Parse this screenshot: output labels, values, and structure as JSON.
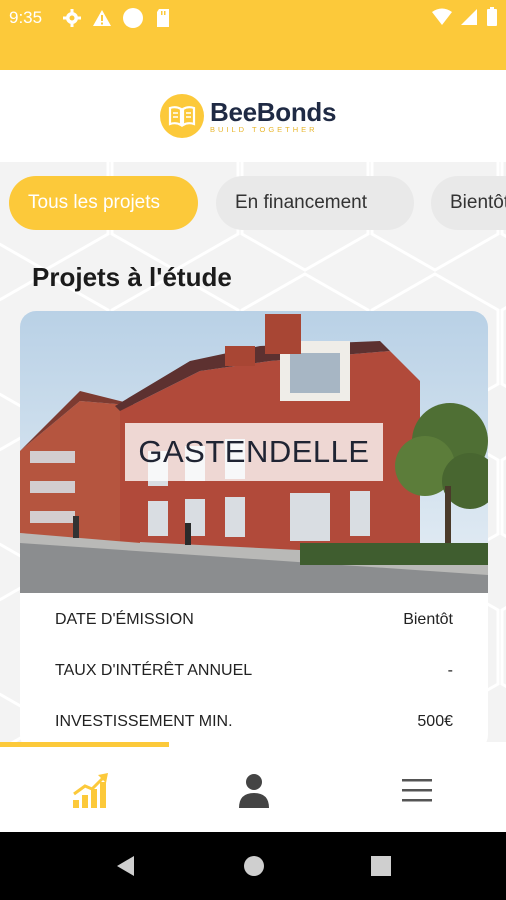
{
  "status_bar": {
    "time": "9:35",
    "icons": [
      "gear-icon",
      "warning-icon",
      "circle-icon",
      "sd-card-icon",
      "wifi-icon",
      "signal-icon",
      "battery-icon"
    ]
  },
  "brand": {
    "name": "BeeBonds",
    "tagline": "BUILD TOGETHER",
    "accent_color": "#fcc93a"
  },
  "filters": {
    "chips": [
      {
        "label": "Tous les projets",
        "active": true
      },
      {
        "label": "En financement",
        "active": false
      },
      {
        "label": "Bientôt",
        "active": false
      }
    ]
  },
  "section": {
    "title": "Projets à l'étude"
  },
  "project": {
    "name": "GASTENDELLE",
    "rows": [
      {
        "label": "DATE D'ÉMISSION",
        "value": "Bientôt"
      },
      {
        "label": "TAUX D'INTÉRÊT ANNUEL",
        "value": "-"
      },
      {
        "label": "INVESTISSEMENT MIN.",
        "value": "500€"
      }
    ]
  },
  "bottom_nav": {
    "items": [
      {
        "icon": "chart-growth-icon",
        "active": true
      },
      {
        "icon": "profile-icon",
        "active": false
      },
      {
        "icon": "menu-icon",
        "active": false
      }
    ]
  },
  "system_nav": {
    "buttons": [
      "back-icon",
      "home-icon",
      "recents-icon"
    ]
  }
}
